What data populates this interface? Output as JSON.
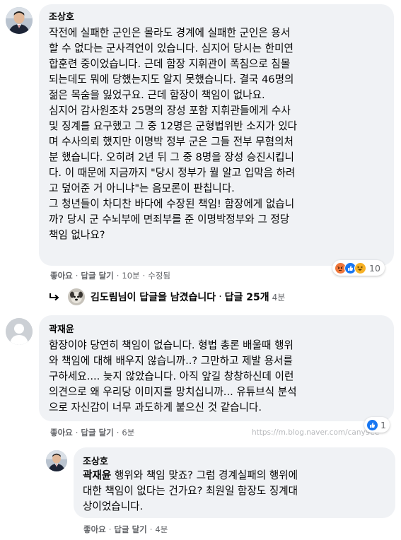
{
  "comment1": {
    "author": "조상호",
    "lines": [
      "작전에 실패한 군인은 몰라도 경계에 실패한 군인은 용서",
      "할 수 없다는 군사격언이 있습니다. 심지어 당시는 한미연",
      "합훈련 중이었습니다. 근데 함장 지휘관이 폭침으로 침몰",
      "되는데도 뭐에 당했는지도 알지 못했습니다. 결국 46명의",
      "젊은 목숨을 잃었구요. 근데 함장이 책임이 없나요.",
      "심지어 감사원조차 25명의 장성 포함 지휘관들에게 수사",
      "및 징계를 요구했고 그 중 12명은 군형법위반 소지가 있다",
      "며 수사의뢰 했지만 이명박 정부 군은 그들 전부 무혐의처",
      "분 했습니다. 오히려 2년 뒤 그 중 8명을 장성 승진시킵니",
      "다. 이 때문에 지금까지 \"당시 정부가 뭘 알고 입막음 하려",
      "고 덮어준 거 아니냐\"는 음모론이 판칩니다.",
      "그 청년들이 차디찬 바다에 수장된 책임! 함장에게 없습니",
      "까? 당시 군 수뇌부에 면죄부를 준 이명박정부와 그 정당",
      "책임 없나요?"
    ],
    "like": "좋아요",
    "reply": "답글 달기",
    "time": "10분",
    "edited": "수정됨",
    "reaction_count": "10"
  },
  "replies_link": {
    "text": "김도림님이 답글을 남겼습니다",
    "count": "답글 25개",
    "time": "4분",
    "arrow_icon": "reply-arrow-icon"
  },
  "comment2": {
    "author": "곽재윤",
    "lines": [
      "함장이야 당연히 책임이 없습니다. 형법 총론 배울때 행위",
      "와 책임에 대해 배우지 않습니까..? 그만하고 제발 용서를",
      "구하세요.... 늦지 않았습니다. 아직 앞길 창창하신데 이런",
      "의견으로 왜 우리당 이미지를 망치십니까... 유튜브식 분석",
      "으로 자신감이 너무 과도하게 붙으신 것 같습니다."
    ],
    "like": "좋아요",
    "reply": "답글 달기",
    "time": "6분",
    "reaction_count": "1"
  },
  "watermark": "https://m.blog.naver.com/cany9ee",
  "comment3": {
    "author": "조상호",
    "mention": "곽재윤",
    "line1_rest": " 행위와 책임 맞죠? 그럼 경계실패의 행위에",
    "line2": "대한 책임이 없다는 건가요? 최원일 함장도 징계대",
    "line3": "상이었습니다.",
    "like": "좋아요",
    "reply": "답글 달기",
    "time": "4분"
  },
  "dot": "·",
  "colors": {
    "bubble": "#f0f2f5",
    "text": "#050505",
    "meta": "#65676b",
    "like_blue": "#1877f2",
    "angry": "#f0773a",
    "haha": "#f7b125"
  }
}
